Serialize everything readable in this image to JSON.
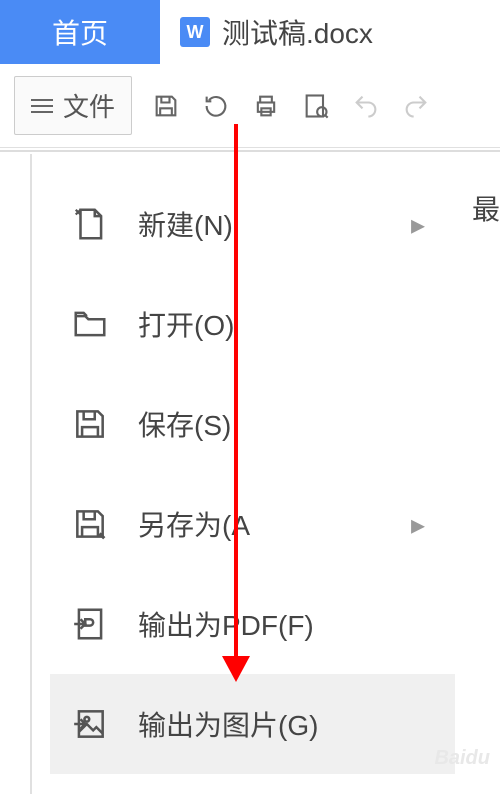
{
  "tabs": {
    "home": "首页",
    "document": "测试稿.docx"
  },
  "toolbar": {
    "file_label": "文件"
  },
  "side": {
    "text": "最"
  },
  "menu": {
    "items": [
      {
        "label": "新建(N)",
        "has_chevron": true
      },
      {
        "label": "打开(O)",
        "has_chevron": false
      },
      {
        "label": "保存(S)",
        "has_chevron": false
      },
      {
        "label": "另存为(A",
        "has_chevron": true
      },
      {
        "label": "输出为PDF(F)",
        "has_chevron": false
      },
      {
        "label": "输出为图片(G)",
        "has_chevron": false
      }
    ]
  },
  "watermark": "Baidu"
}
